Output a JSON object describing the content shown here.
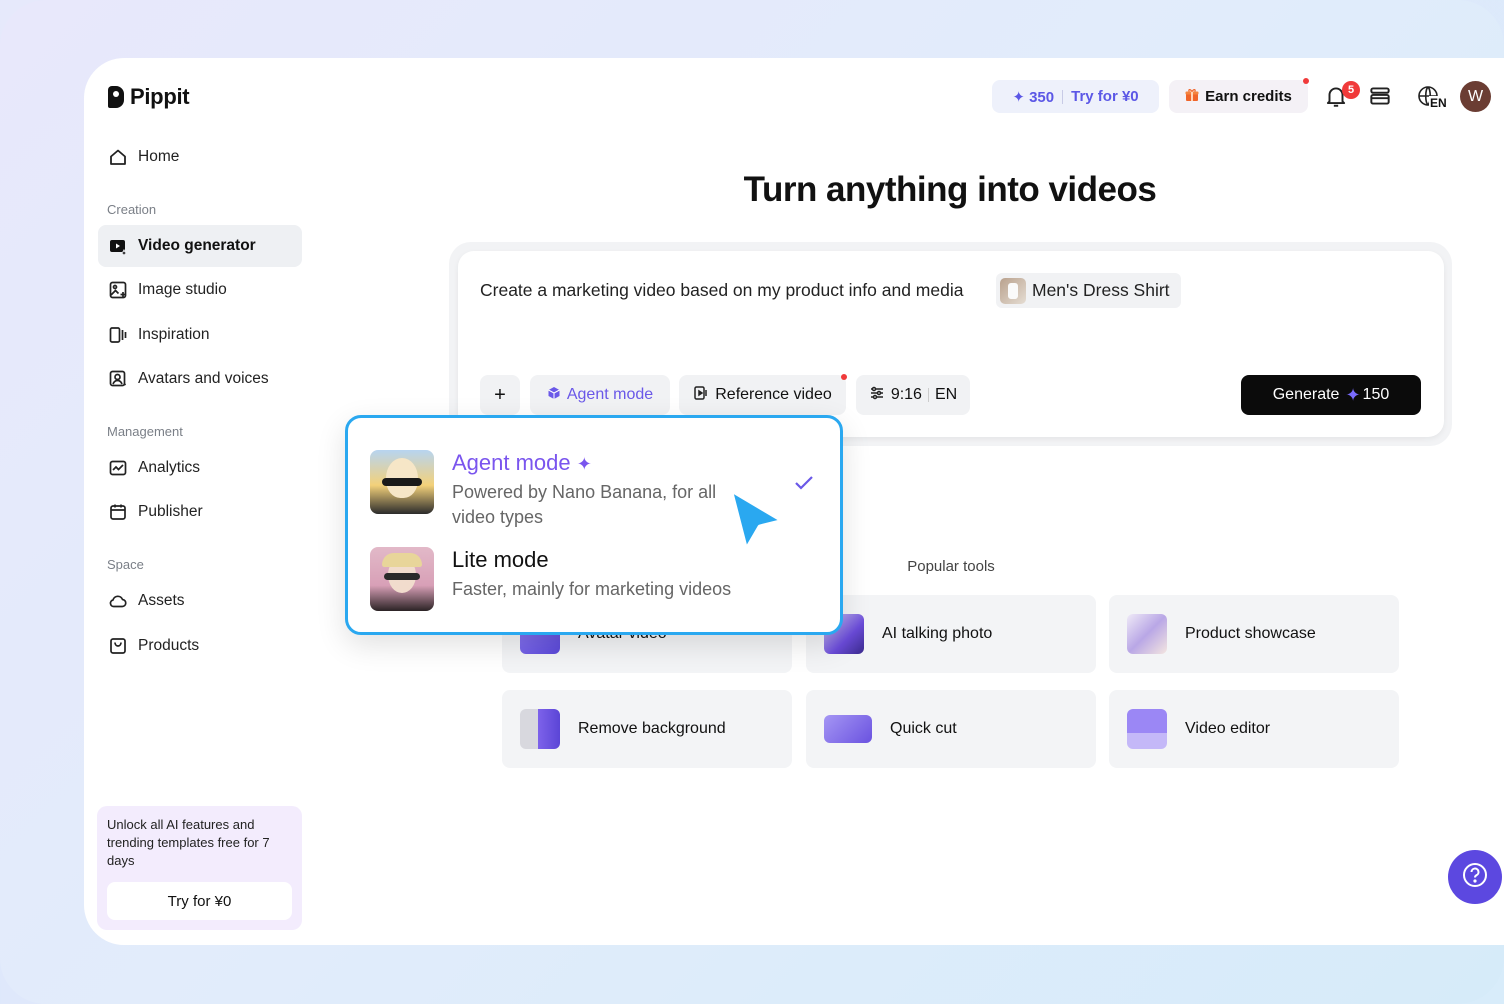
{
  "app": {
    "name": "Pippit"
  },
  "sidebar": {
    "home": "Home",
    "sections": {
      "creation": "Creation",
      "management": "Management",
      "space": "Space"
    },
    "creation_items": [
      {
        "label": "Video generator",
        "icon": "video-generator-icon",
        "active": true
      },
      {
        "label": "Image studio",
        "icon": "image-studio-icon"
      },
      {
        "label": "Inspiration",
        "icon": "inspiration-icon"
      },
      {
        "label": "Avatars and voices",
        "icon": "avatar-voice-icon"
      }
    ],
    "management_items": [
      {
        "label": "Analytics",
        "icon": "analytics-icon"
      },
      {
        "label": "Publisher",
        "icon": "calendar-icon"
      }
    ],
    "space_items": [
      {
        "label": "Assets",
        "icon": "cloud-icon"
      },
      {
        "label": "Products",
        "icon": "product-box-icon"
      }
    ],
    "promo": {
      "text": "Unlock all AI features and trending templates free for 7 days",
      "button": "Try for ¥0"
    }
  },
  "topbar": {
    "credits": "350",
    "try_label": "Try for ¥0",
    "earn_label": "Earn credits",
    "notification_count": "5",
    "language": "EN",
    "avatar_initial": "W"
  },
  "main": {
    "headline": "Turn anything into videos",
    "prompt": {
      "text": "Create a marketing video based on my product info and media",
      "product_chip": "Men's Dress Shirt"
    },
    "toolbar": {
      "add": "+",
      "agent_mode": "Agent mode",
      "reference_video": "Reference video",
      "ratio": "9:16",
      "language": "EN",
      "generate": "Generate",
      "generate_cost": "150"
    },
    "popular_label": "Popular tools",
    "tools": [
      {
        "label": "Avatar video"
      },
      {
        "label": "AI talking photo"
      },
      {
        "label": "Product showcase"
      },
      {
        "label": "Remove background"
      },
      {
        "label": "Quick cut"
      },
      {
        "label": "Video editor"
      }
    ]
  },
  "mode_dropdown": {
    "modes": [
      {
        "title": "Agent mode",
        "desc": "Powered by Nano Banana, for all video types",
        "selected": true
      },
      {
        "title": "Lite mode",
        "desc": "Faster, mainly for marketing videos",
        "selected": false
      }
    ]
  },
  "colors": {
    "accent": "#6a58e8",
    "highlight_border": "#2aa8f0",
    "help_button": "#5c48e0"
  }
}
